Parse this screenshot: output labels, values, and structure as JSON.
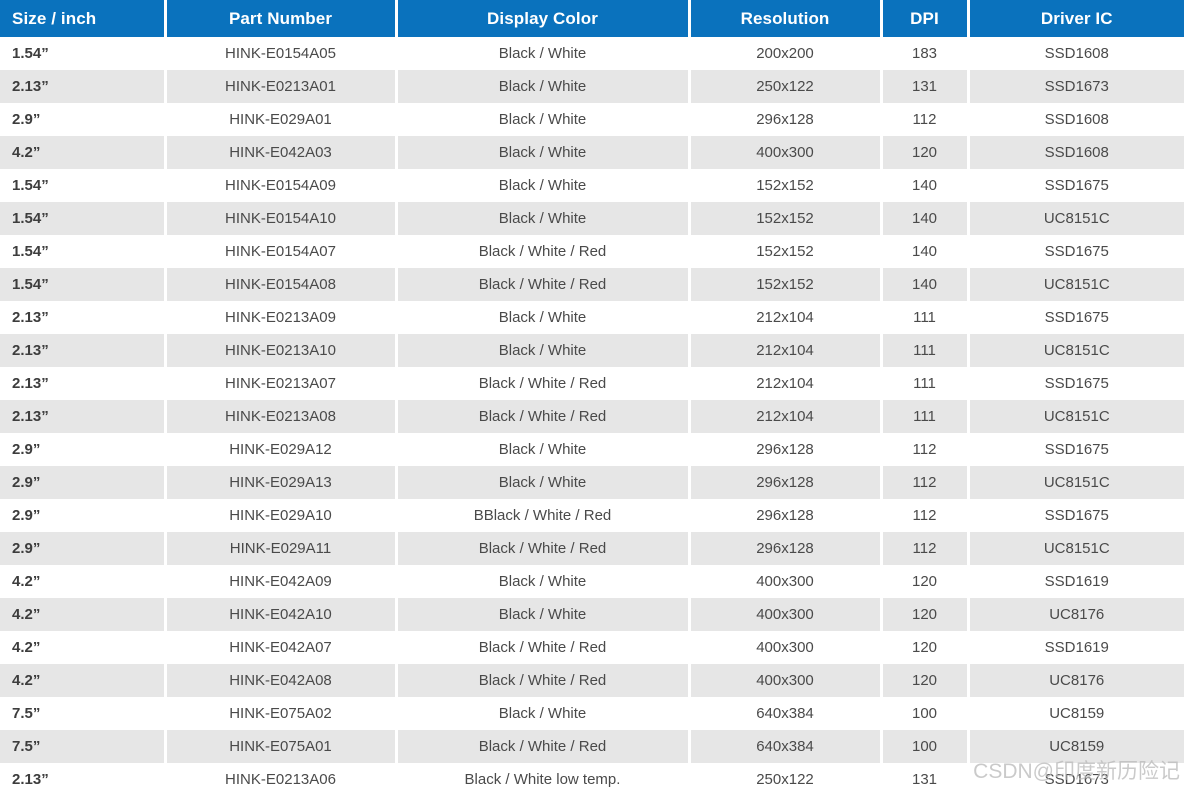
{
  "theme": {
    "header_background": "#0a72bd",
    "header_text": "#ffffff",
    "row_odd_background": "#ffffff",
    "row_even_background": "#e6e6e6",
    "cell_text": "#4a4a4a",
    "watermark_color": "#b9b9b9"
  },
  "table": {
    "columns": [
      {
        "key": "size",
        "label": "Size / inch"
      },
      {
        "key": "part_number",
        "label": "Part Number"
      },
      {
        "key": "display_color",
        "label": "Display Color"
      },
      {
        "key": "resolution",
        "label": "Resolution"
      },
      {
        "key": "dpi",
        "label": "DPI"
      },
      {
        "key": "driver_ic",
        "label": "Driver IC"
      }
    ],
    "rows": [
      {
        "size": "1.54”",
        "part_number": "HINK-E0154A05",
        "display_color": "Black / White",
        "resolution": "200x200",
        "dpi": "183",
        "driver_ic": "SSD1608"
      },
      {
        "size": "2.13”",
        "part_number": "HINK-E0213A01",
        "display_color": "Black / White",
        "resolution": "250x122",
        "dpi": "131",
        "driver_ic": "SSD1673"
      },
      {
        "size": "2.9”",
        "part_number": "HINK-E029A01",
        "display_color": "Black / White",
        "resolution": "296x128",
        "dpi": "112",
        "driver_ic": "SSD1608"
      },
      {
        "size": "4.2”",
        "part_number": "HINK-E042A03",
        "display_color": "Black / White",
        "resolution": "400x300",
        "dpi": "120",
        "driver_ic": "SSD1608"
      },
      {
        "size": "1.54”",
        "part_number": "HINK-E0154A09",
        "display_color": "Black / White",
        "resolution": "152x152",
        "dpi": "140",
        "driver_ic": "SSD1675"
      },
      {
        "size": "1.54”",
        "part_number": "HINK-E0154A10",
        "display_color": "Black / White",
        "resolution": "152x152",
        "dpi": "140",
        "driver_ic": "UC8151C"
      },
      {
        "size": "1.54”",
        "part_number": "HINK-E0154A07",
        "display_color": "Black / White / Red",
        "resolution": "152x152",
        "dpi": "140",
        "driver_ic": "SSD1675"
      },
      {
        "size": "1.54”",
        "part_number": "HINK-E0154A08",
        "display_color": "Black / White / Red",
        "resolution": "152x152",
        "dpi": "140",
        "driver_ic": "UC8151C"
      },
      {
        "size": "2.13”",
        "part_number": "HINK-E0213A09",
        "display_color": "Black / White",
        "resolution": "212x104",
        "dpi": "111",
        "driver_ic": "SSD1675"
      },
      {
        "size": "2.13”",
        "part_number": "HINK-E0213A10",
        "display_color": "Black / White",
        "resolution": "212x104",
        "dpi": "111",
        "driver_ic": "UC8151C"
      },
      {
        "size": "2.13”",
        "part_number": "HINK-E0213A07",
        "display_color": "Black / White / Red",
        "resolution": "212x104",
        "dpi": "111",
        "driver_ic": "SSD1675"
      },
      {
        "size": "2.13”",
        "part_number": "HINK-E0213A08",
        "display_color": "Black / White / Red",
        "resolution": "212x104",
        "dpi": "111",
        "driver_ic": "UC8151C"
      },
      {
        "size": "2.9”",
        "part_number": "HINK-E029A12",
        "display_color": "Black / White",
        "resolution": "296x128",
        "dpi": "112",
        "driver_ic": "SSD1675"
      },
      {
        "size": "2.9”",
        "part_number": "HINK-E029A13",
        "display_color": "Black / White",
        "resolution": "296x128",
        "dpi": "112",
        "driver_ic": "UC8151C"
      },
      {
        "size": "2.9”",
        "part_number": "HINK-E029A10",
        "display_color": "BBlack / White / Red",
        "resolution": "296x128",
        "dpi": "112",
        "driver_ic": "SSD1675"
      },
      {
        "size": "2.9”",
        "part_number": "HINK-E029A11",
        "display_color": "Black / White / Red",
        "resolution": "296x128",
        "dpi": "112",
        "driver_ic": "UC8151C"
      },
      {
        "size": "4.2”",
        "part_number": "HINK-E042A09",
        "display_color": "Black / White",
        "resolution": "400x300",
        "dpi": "120",
        "driver_ic": "SSD1619"
      },
      {
        "size": "4.2”",
        "part_number": "HINK-E042A10",
        "display_color": "Black / White",
        "resolution": "400x300",
        "dpi": "120",
        "driver_ic": "UC8176"
      },
      {
        "size": "4.2”",
        "part_number": "HINK-E042A07",
        "display_color": "Black / White / Red",
        "resolution": "400x300",
        "dpi": "120",
        "driver_ic": "SSD1619"
      },
      {
        "size": "4.2”",
        "part_number": "HINK-E042A08",
        "display_color": "Black / White / Red",
        "resolution": "400x300",
        "dpi": "120",
        "driver_ic": "UC8176"
      },
      {
        "size": "7.5”",
        "part_number": "HINK-E075A02",
        "display_color": "Black / White",
        "resolution": "640x384",
        "dpi": "100",
        "driver_ic": "UC8159"
      },
      {
        "size": "7.5”",
        "part_number": "HINK-E075A01",
        "display_color": "Black / White / Red",
        "resolution": "640x384",
        "dpi": "100",
        "driver_ic": "UC8159"
      },
      {
        "size": "2.13”",
        "part_number": "HINK-E0213A06",
        "display_color": "Black / White low temp.",
        "resolution": "250x122",
        "dpi": "131",
        "driver_ic": "SSD1673"
      }
    ]
  },
  "watermark": {
    "text": "CSDN@印度新历险记"
  }
}
